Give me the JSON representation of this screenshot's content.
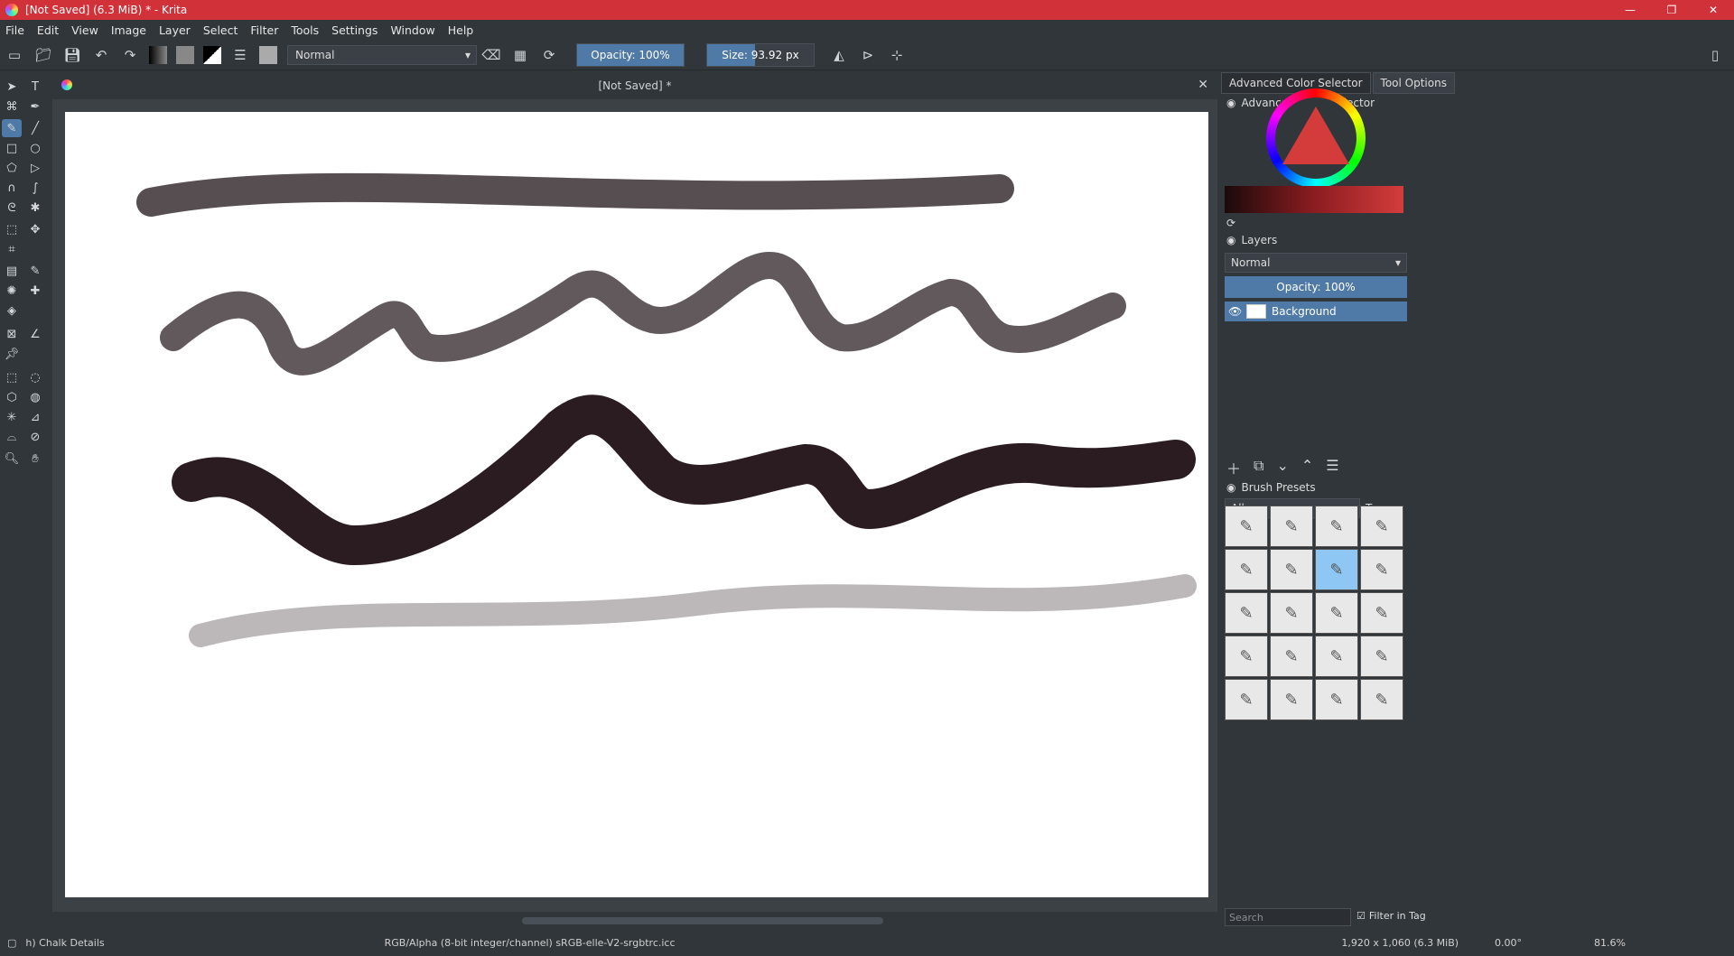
{
  "window": {
    "title": "[Not Saved]  (6.3 MiB)  * - Krita",
    "minimize": "—",
    "restore": "❐",
    "close": "✕"
  },
  "menu": [
    "File",
    "Edit",
    "View",
    "Image",
    "Layer",
    "Select",
    "Filter",
    "Tools",
    "Settings",
    "Window",
    "Help"
  ],
  "toolbar": {
    "blend_mode": "Normal",
    "opacity_label": "Opacity: 100%",
    "opacity_value": 100,
    "size_label": "Size: 93.92 px"
  },
  "document": {
    "tab_title": "[Not Saved]  *"
  },
  "dock": {
    "tabs": [
      "Advanced Color Selector",
      "Tool Options"
    ],
    "color_selector_title": "Advanced Color Selector",
    "layers_title": "Layers",
    "layers_blend": "Normal",
    "layers_opacity": "Opacity:  100%",
    "layer_name": "Background",
    "brush_presets_title": "Brush Presets",
    "presets_filter": "All",
    "tag_label": "Tag",
    "search_placeholder": "Search",
    "filter_in_tag": "Filter in Tag"
  },
  "status": {
    "brush": "h) Chalk Details",
    "color_space": "RGB/Alpha (8-bit integer/channel)  sRGB-elle-V2-srgbtrc.icc",
    "dimensions": "1,920 x 1,060 (6.3 MiB)",
    "rotation": "0.00°",
    "zoom": "81.6%"
  }
}
